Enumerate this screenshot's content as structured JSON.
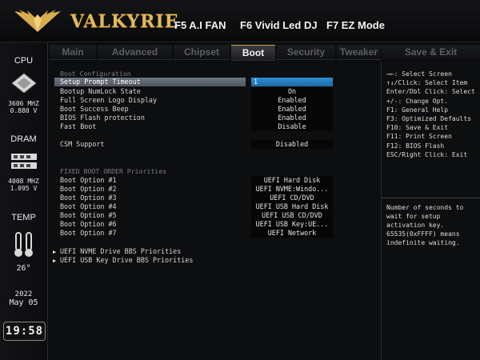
{
  "header": {
    "brand": "VALKYRIE",
    "menu": [
      {
        "label": "F5 A.I FAN"
      },
      {
        "label": "F6 Vivid Led DJ"
      },
      {
        "label": "F7 EZ Mode"
      }
    ]
  },
  "left_panel": {
    "cpu_label": "CPU",
    "cpu_freq": "3606 MHZ",
    "cpu_volt": "0.880 V",
    "dram_label": "DRAM",
    "dram_freq": "4008 MHZ",
    "dram_volt": "1.095 V",
    "temp_label": "TEMP",
    "temp_value": "26°",
    "year": "2022",
    "date": "May 05",
    "time": "19:58"
  },
  "tabs": [
    {
      "label": "Main"
    },
    {
      "label": "Advanced"
    },
    {
      "label": "Chipset"
    },
    {
      "label": "Boot"
    },
    {
      "label": "Security"
    },
    {
      "label": "Tweaker"
    },
    {
      "label": "Save & Exit"
    }
  ],
  "active_tab": "Boot",
  "main": {
    "section_title": "Boot Configuration",
    "settings": [
      {
        "label": "Setup Prompt Timeout",
        "value": "1"
      },
      {
        "label": "Bootup NumLock State",
        "value": "On"
      },
      {
        "label": "Full Screen Logo Display",
        "value": "Enabled"
      },
      {
        "label": "Boot Success Beep",
        "value": "Enabled"
      },
      {
        "label": "BIOS Flash protection",
        "value": "Enabled"
      },
      {
        "label": "Fast Boot",
        "value": "Disable"
      },
      {
        "label": "CSM Support",
        "value": "Disabled"
      }
    ],
    "priorities_title": "FIXED BOOT ORDER Priorities",
    "boot_options": [
      {
        "label": "Boot Option #1",
        "value": "UEFI Hard Disk"
      },
      {
        "label": "Boot Option #2",
        "value": "UEFI NVME:Windo..."
      },
      {
        "label": "Boot Option #3",
        "value": "UEFI CD/DVD"
      },
      {
        "label": "Boot Option #4",
        "value": "UEFI USB Hard Disk"
      },
      {
        "label": "Boot Option #5",
        "value": "UEFI USB CD/DVD"
      },
      {
        "label": "Boot Option #6",
        "value": "UEFI USB Key:UE..."
      },
      {
        "label": "Boot Option #7",
        "value": "UEFI Network"
      }
    ],
    "submenus": [
      {
        "label": "UEFI NVME Drive BBS Priorities"
      },
      {
        "label": "UEFI USB Key Drive BBS Priorities"
      }
    ]
  },
  "help": {
    "keys": [
      "→←: Select Screen",
      "↑↓/Click: Select Item",
      "Enter/Dbl Click: Select",
      "+/-: Change Opt.",
      "F1: General Help",
      "F3: Optimized Defaults",
      "F10: Save & Exit",
      "F11: Print Screen",
      "F12: BIOS Flash",
      "ESC/Right Click: Exit"
    ],
    "description": "Number of seconds to\nwait for setup\nactivation key.\n65535(0xFFFF) means\nindefinite waiting."
  },
  "colors": {
    "brand_gold": "#e2b85a",
    "selection_blue": "#1f7bc0",
    "tab_active_border": "#c8a44c"
  }
}
